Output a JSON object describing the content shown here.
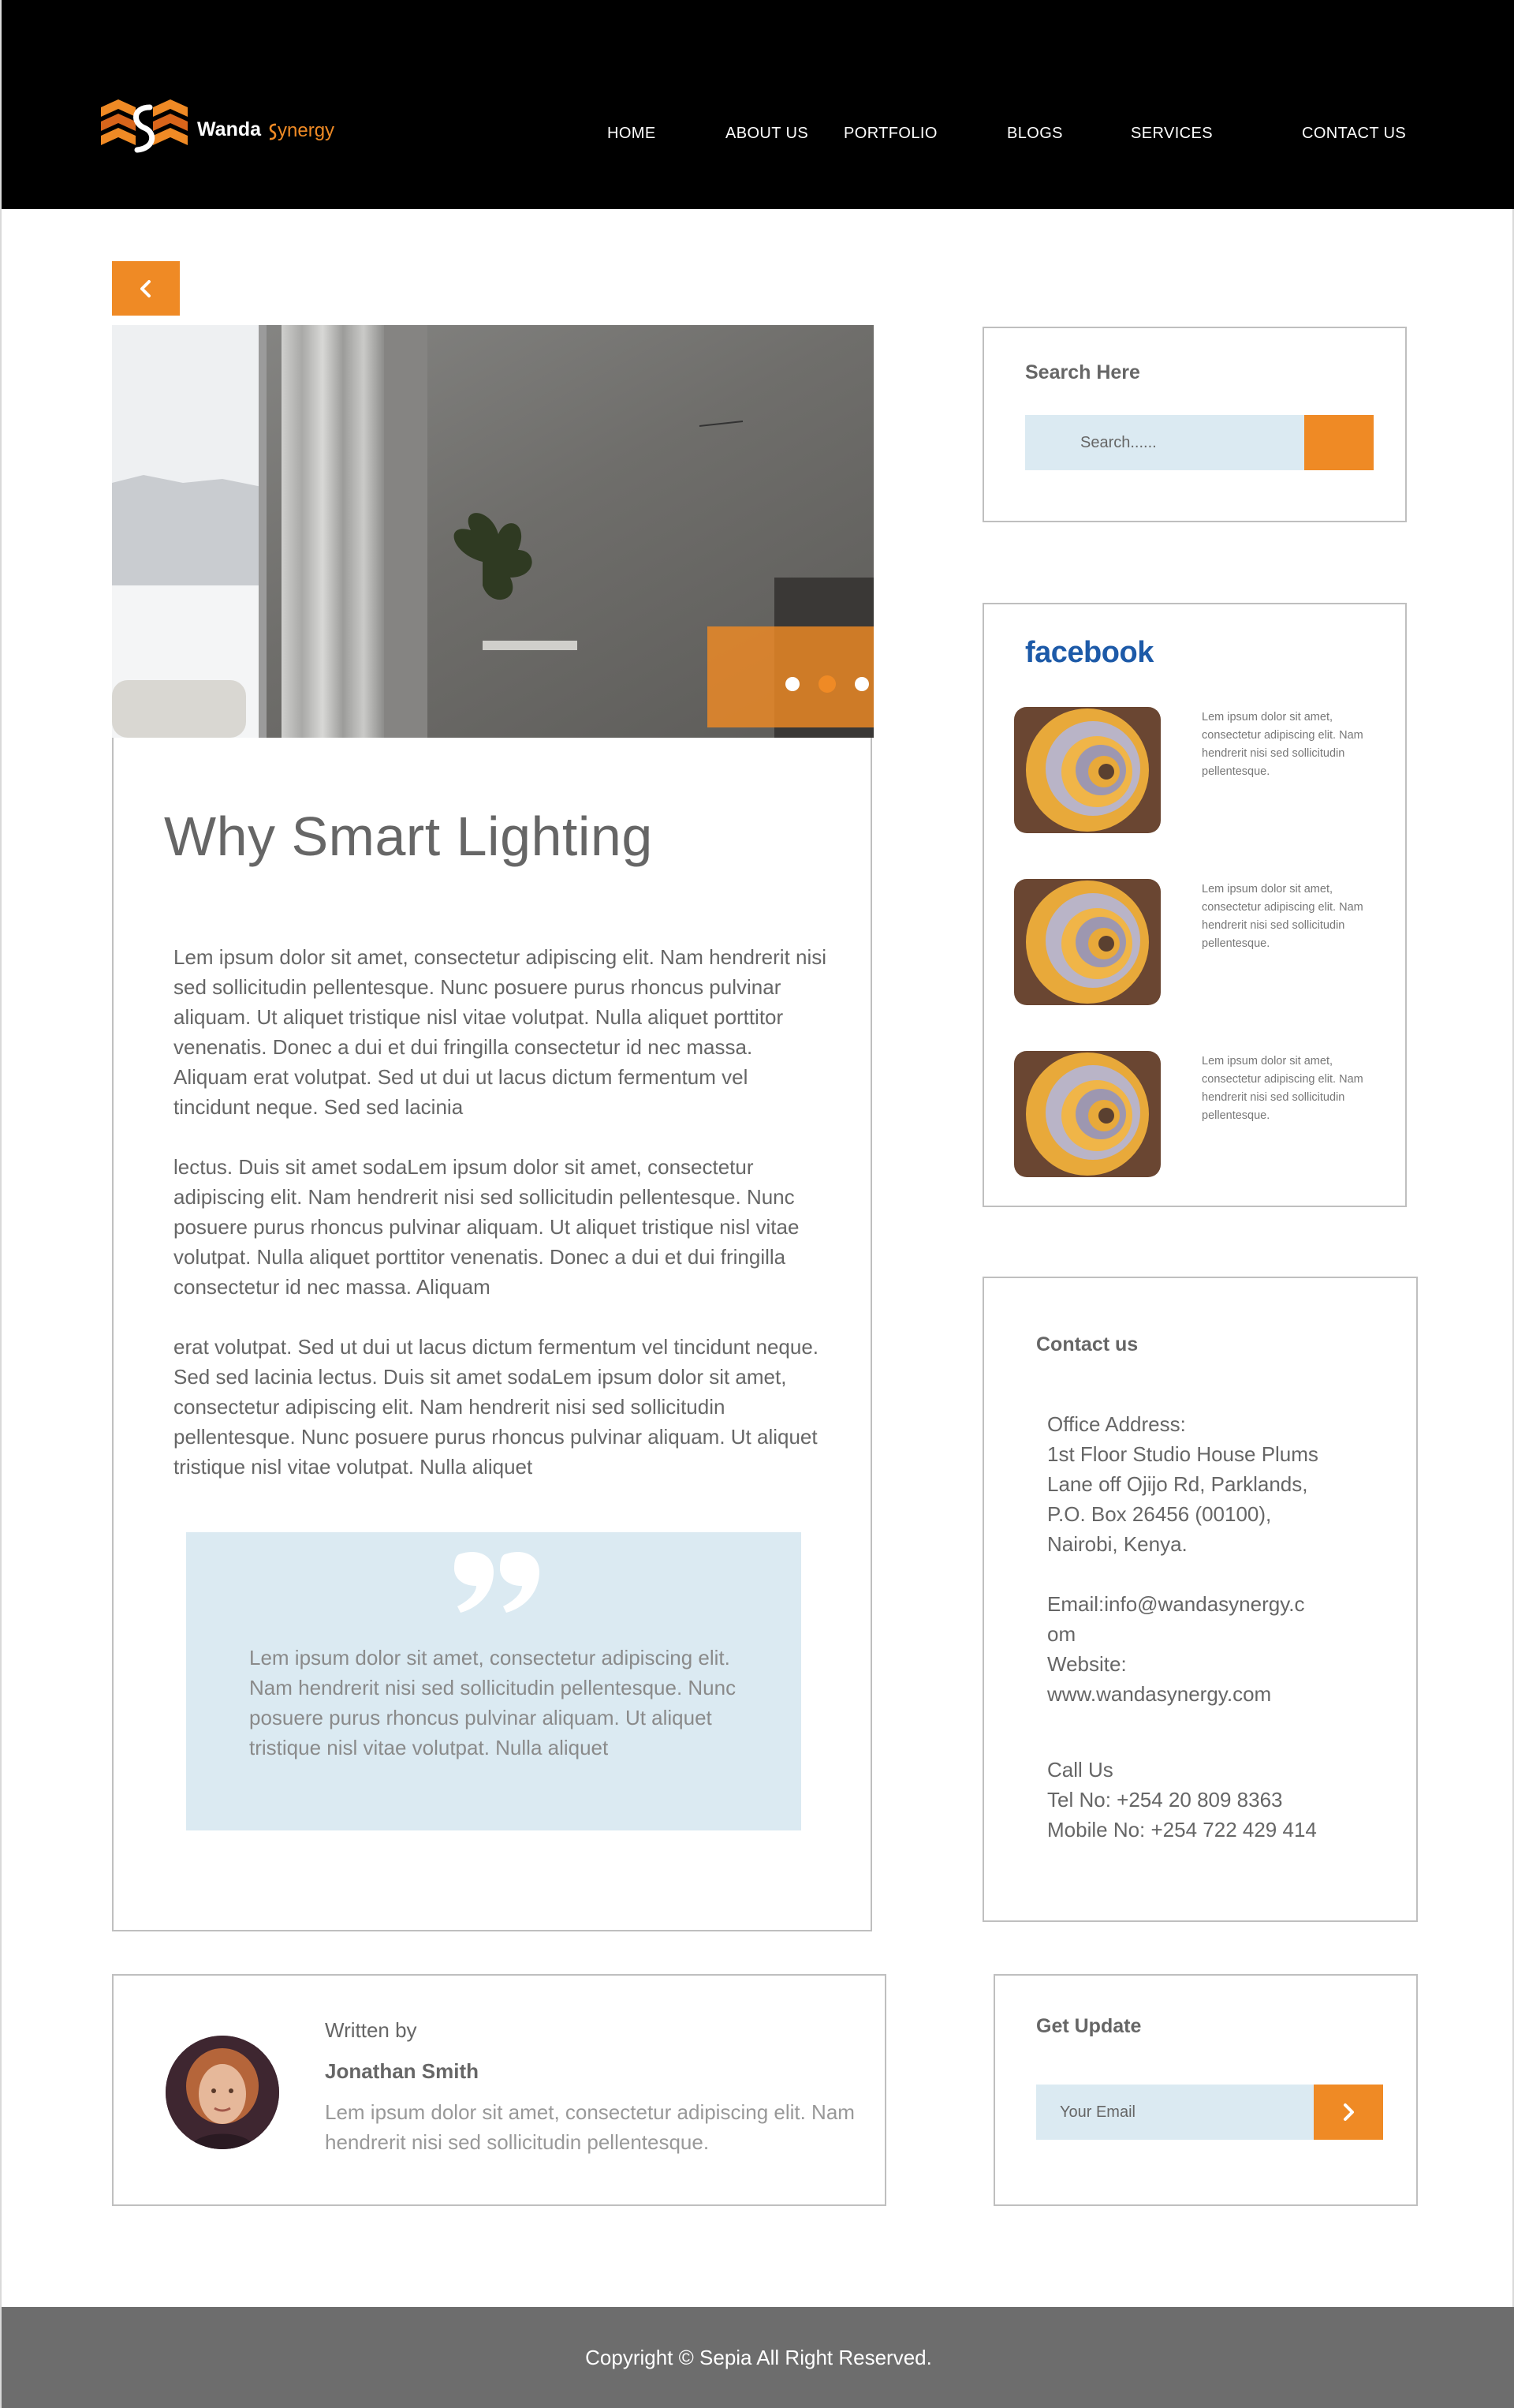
{
  "brand": {
    "name_part1": "Wanda",
    "name_part2": "ynergy",
    "accent_color": "#ef8a25",
    "header_bg": "#000000"
  },
  "nav": {
    "items": [
      {
        "label": "HOME"
      },
      {
        "label": "ABOUT US"
      },
      {
        "label": "PORTFOLIO"
      },
      {
        "label": "BLOGS"
      },
      {
        "label": "SERVICES"
      },
      {
        "label": "CONTACT US"
      }
    ]
  },
  "back_button": {
    "icon": "chevron-left-icon"
  },
  "slider": {
    "slide_count": 4,
    "active_slide": 2
  },
  "article": {
    "title": "Why Smart Lighting",
    "paragraphs": [
      "Lem ipsum dolor sit amet, consectetur adipiscing elit. Nam hendrerit nisi sed sollicitudin pellentesque. Nunc posuere purus rhoncus pulvinar aliquam. Ut aliquet tristique nisl vitae volutpat. Nulla aliquet porttitor venenatis. Donec a dui et dui fringilla consectetur id nec massa. Aliquam erat volutpat. Sed ut dui ut lacus dictum fermentum vel tincidunt neque. Sed sed lacinia",
      "lectus. Duis sit amet sodaLem ipsum dolor sit amet, consectetur adipiscing elit. Nam hendrerit nisi sed sollicitudin pellentesque. Nunc posuere purus rhoncus pulvinar aliquam. Ut aliquet tristique nisl vitae volutpat. Nulla aliquet porttitor venenatis. Donec a dui et dui fringilla consectetur id nec massa. Aliquam",
      "erat volutpat. Sed ut dui ut lacus dictum fermentum vel tincidunt neque. Sed sed lacinia lectus. Duis sit amet sodaLem ipsum dolor sit amet, consectetur adipiscing elit. Nam hendrerit nisi sed sollicitudin pellentesque. Nunc posuere purus rhoncus pulvinar aliquam. Ut aliquet tristique nisl vitae volutpat. Nulla aliquet"
    ],
    "quote": "Lem ipsum dolor sit amet, consectetur adipiscing elit. Nam hendrerit nisi sed sollicitudin pellentesque. Nunc posuere purus rhoncus pulvinar aliquam. Ut aliquet tristique nisl vitae volutpat. Nulla aliquet"
  },
  "search": {
    "title": "Search Here",
    "placeholder": "Search......"
  },
  "facebook": {
    "logo": "facebook",
    "brand_color": "#1d5aa8",
    "posts": [
      {
        "text": "Lem ipsum dolor sit amet, consectetur adipiscing elit. Nam hendrerit nisi sed sollicitudin pellentesque."
      },
      {
        "text": "Lem ipsum dolor sit amet, consectetur adipiscing elit. Nam hendrerit nisi sed sollicitudin pellentesque."
      },
      {
        "text": "Lem ipsum dolor sit amet, consectetur adipiscing elit. Nam hendrerit nisi sed sollicitudin pellentesque."
      }
    ]
  },
  "contact": {
    "title": "Contact us",
    "address_label": "Office Address:",
    "address_lines": [
      "1st Floor Studio House Plums",
      "Lane off Ojijo Rd, Parklands,",
      "P.O. Box 26456 (00100),",
      "Nairobi, Kenya."
    ],
    "email_lines": [
      "Email:info@wandasynergy.c",
      "om"
    ],
    "website_label": "Website:",
    "website": "www.wandasynergy.com",
    "call_label": "Call Us",
    "tel": "Tel No: +254 20 809 8363",
    "mobile": "Mobile No: +254 722 429 414"
  },
  "author": {
    "written_by": "Written by",
    "name": "Jonathan Smith",
    "bio": "Lem ipsum dolor sit amet, consectetur adipiscing elit. Nam hendrerit nisi sed sollicitudin pellentesque."
  },
  "newsletter": {
    "title": "Get Update",
    "placeholder": "Your Email"
  },
  "footer": {
    "copyright": "Copyright © Sepia All Right Reserved."
  }
}
